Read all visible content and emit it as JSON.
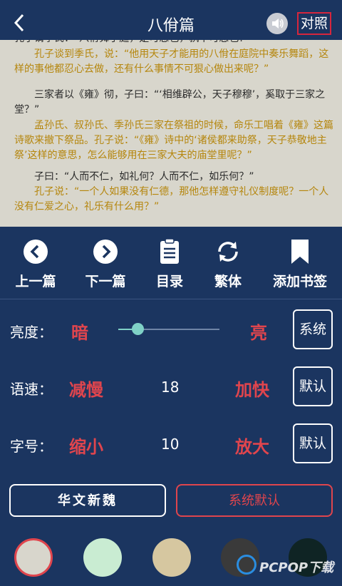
{
  "header": {
    "title": "八佾篇",
    "compare_label": "对照"
  },
  "reader": {
    "paragraphs": [
      {
        "orig_partial": "孔子谓季氏：“八佾舞于庭，是可忍也，孰不可忍也？”",
        "trans": "孔子谈到季氏，说：“他用天子才能用的八佾在庭院中奏乐舞蹈，这样的事他都忍心去做，还有什么事情不可狠心做出来呢？”"
      },
      {
        "orig": "三家者以《雍》彻，子曰：“‘相维辟公，天子穆穆’，奚取于三家之堂？”",
        "trans": "孟孙氏、叔孙氏、季孙氏三家在祭祖的时候，命乐工唱着《雍》这篇诗歌来撤下祭品。孔子说：“《雍》诗中的‘诸侯都来助祭，天子恭敬地主祭’这样的意思，怎么能够用在三家大夫的庙堂里呢？”"
      },
      {
        "orig": "子曰：“人而不仁，如礼何？人而不仁，如乐何？”",
        "trans": "孔子说：“一个人如果没有仁德，那他怎样遵守礼仪制度呢？一个人没有仁爱之心，礼乐有什么用？”"
      }
    ]
  },
  "nav": {
    "prev": "上一篇",
    "next": "下一篇",
    "toc": "目录",
    "traditional": "繁体",
    "bookmark": "添加书签"
  },
  "brightness": {
    "label": "亮度：",
    "dark": "暗",
    "bright": "亮",
    "button": "系统",
    "level": 0.19
  },
  "speed": {
    "label": "语速：",
    "slower": "减慢",
    "value": "18",
    "faster": "加快",
    "button": "默认"
  },
  "fontsize": {
    "label": "字号：",
    "smaller": "缩小",
    "value": "10",
    "larger": "放大",
    "button": "默认"
  },
  "fonts": {
    "font1": "华文新魏",
    "font2": "系统默认"
  },
  "swatches": [
    "#d8d6cc",
    "#c9ecd2",
    "#d6c7a0",
    "#3a3a3a",
    "#0f2424"
  ],
  "watermark": "PCPOP下载"
}
